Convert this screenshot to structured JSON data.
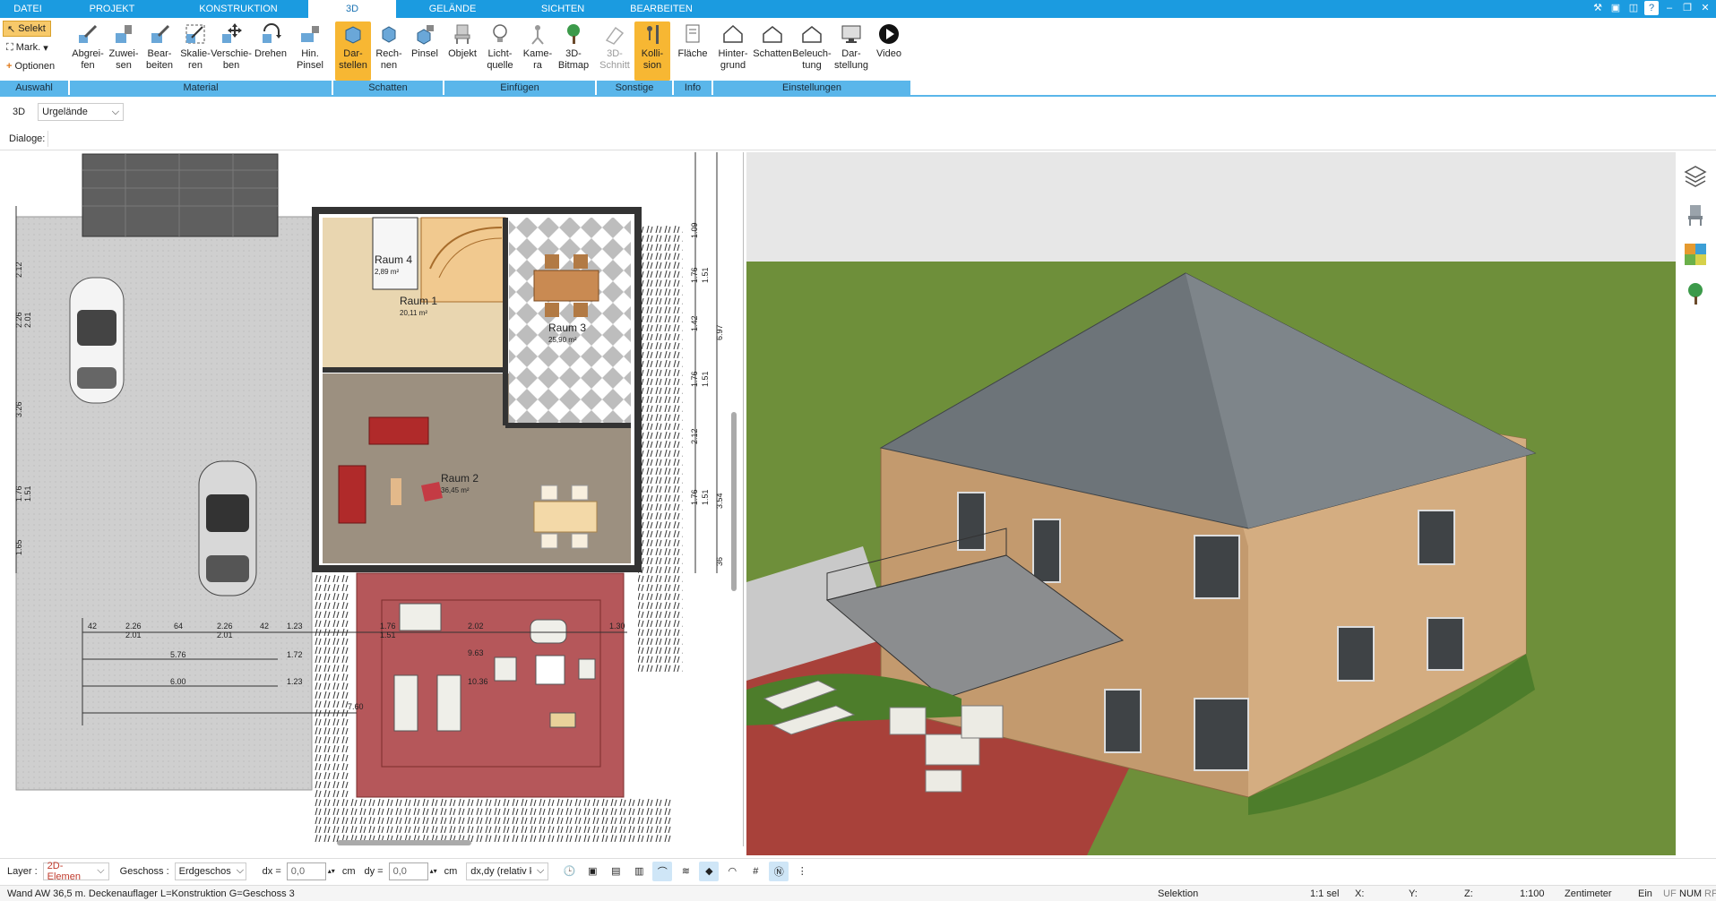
{
  "tabs": [
    {
      "label": "DATEI"
    },
    {
      "label": "PROJEKT"
    },
    {
      "label": "KONSTRUKTION"
    },
    {
      "label": "3D"
    },
    {
      "label": "GELÄNDE"
    },
    {
      "label": "SICHTEN"
    },
    {
      "label": "BEARBEITEN"
    }
  ],
  "ribbon": {
    "auswahl": {
      "select_label": "Selekt",
      "mark_label": "Mark.",
      "options_label": "Optionen",
      "group_label": "Auswahl"
    },
    "material": {
      "group_label": "Material",
      "buttons": [
        "Abgrei-\nfen",
        "Zuwei-\nsen",
        "Bear-\nbeiten",
        "Skalie-\nren",
        "Verschie-\nben",
        "Drehen",
        "Hin.\nPinsel"
      ]
    },
    "schatten": {
      "group_label": "Schatten",
      "buttons": [
        "Dar-\nstellen",
        "Rech-\nnen",
        "Pinsel"
      ]
    },
    "einfuegen": {
      "group_label": "Einfügen",
      "buttons": [
        "Objekt",
        "Licht-\nquelle",
        "Kame-\nra",
        "3D-\nBitmap"
      ]
    },
    "sonstige": {
      "group_label": "Sonstige",
      "buttons": [
        "3D-\nSchnitt",
        "Kolli-\nsion"
      ]
    },
    "info": {
      "group_label": "Info",
      "buttons": [
        "Fläche"
      ]
    },
    "einstellungen": {
      "group_label": "Einstellungen",
      "buttons": [
        "Hinter-\ngrund",
        "Schatten",
        "Beleuch-\ntung",
        "Dar-\nstellung",
        "Video"
      ]
    }
  },
  "row2": {
    "mode_label": "3D",
    "terrain_value": "Urgelände"
  },
  "row3": {
    "dialoge_label": "Dialoge:"
  },
  "plan": {
    "rooms": [
      {
        "name": "Raum 4",
        "area": "2,89 m²"
      },
      {
        "name": "Raum 1",
        "area": "20,11 m²"
      },
      {
        "name": "Raum 3",
        "area": "25,90 m²"
      },
      {
        "name": "Raum 2",
        "area": "36,45 m²"
      }
    ],
    "dims_top": [
      "2.26",
      "2.01",
      "2.26",
      "2.01",
      "5.76",
      "1.72",
      "6.00",
      "1.76",
      "1.51",
      "2.02",
      "9.63",
      "10.36",
      "1.30",
      "1.23",
      "42",
      "64",
      "42",
      "7.60"
    ],
    "dims_right": [
      "1.09",
      "1.76",
      "1.51",
      "1.42",
      "6.97",
      "1.76",
      "1.51",
      "2.12",
      "1.76",
      "1.51",
      "3.54",
      "36"
    ],
    "dims_left": [
      "2.12",
      "2.26",
      "2.01",
      "3.26",
      "1.76",
      "1.51",
      "1.65"
    ]
  },
  "bottom": {
    "layer_label": "Layer :",
    "layer_value": "2D-Elemen",
    "geschoss_label": "Geschoss :",
    "geschoss_value": "Erdgeschos",
    "dx_label": "dx =",
    "dx_value": "0,0",
    "dx_unit": "cm",
    "dy_label": "dy =",
    "dy_value": "0,0",
    "dy_unit": "cm",
    "mode_value": "dx,dy (relativ ka"
  },
  "status": {
    "message": "Wand AW 36,5 m. Deckenauflager L=Konstruktion G=Geschoss 3",
    "selektion": "Selektion",
    "sel_count": "1:1 sel",
    "x_label": "X:",
    "y_label": "Y:",
    "z_label": "Z:",
    "scale": "1:100",
    "unit": "Zentimeter",
    "ein": "Ein",
    "uf": "UF",
    "num": "NUM",
    "rf": "RF"
  },
  "colors": {
    "accent": "#1b9be0",
    "ribbon_label_bg": "#5ab6ea",
    "active_button": "#f7b733",
    "sky": "#e7e7e7",
    "grass": "#6e8f3a",
    "roof": "#6d7479",
    "wall": "#c39a6e",
    "terrace": "#a8413a"
  }
}
